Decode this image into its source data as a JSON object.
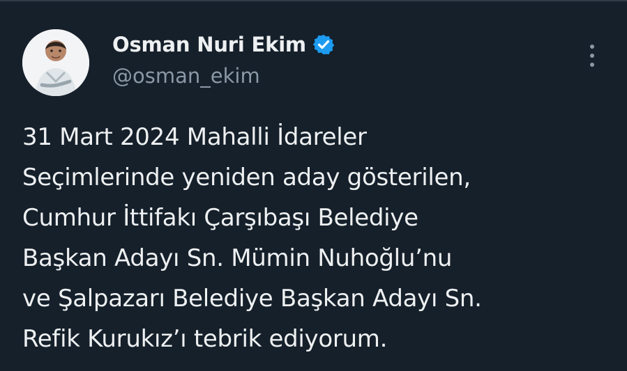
{
  "author": {
    "display_name": "Osman Nuri Ekim",
    "handle": "@osman_ekim",
    "verified": true,
    "verified_color": "#1d9bf0"
  },
  "tweet": {
    "lines": [
      "31 Mart 2024 Mahalli İdareler",
      "Seçimlerinde yeniden aday gösterilen,",
      "Cumhur İttifakı Çarşıbaşı Belediye",
      "Başkan Adayı Sn. Mümin Nuhoğlu’nu",
      "ve Şalpazarı Belediye Başkan Adayı Sn.",
      "Refik Kurukız’ı tebrik ediyorum."
    ]
  },
  "icons": {
    "avatar": "profile-photo",
    "verified": "verified-badge-icon",
    "more": "more-options-icon"
  },
  "theme": {
    "background": "#15202b",
    "text": "#e7e9ea",
    "secondary_text": "#8b98a5"
  }
}
